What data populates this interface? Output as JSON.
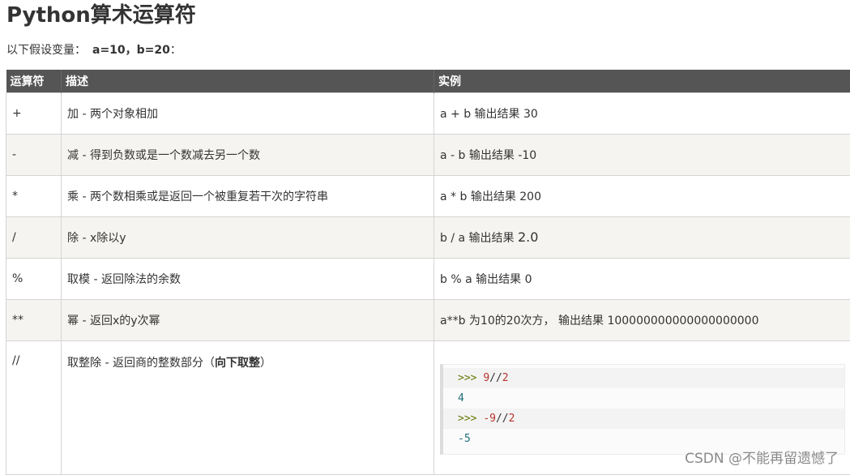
{
  "title": "Python算术运算符",
  "intro": {
    "text": "以下假设变量：",
    "vars": "a=10，b=20",
    "colon": "："
  },
  "table": {
    "headers": [
      "运算符",
      "描述",
      "实例"
    ],
    "rows": [
      {
        "op": "+",
        "desc": "加 - 两个对象相加",
        "example": "a + b 输出结果 30"
      },
      {
        "op": "-",
        "desc": "减 - 得到负数或是一个数减去另一个数",
        "example": "a - b 输出结果 -10"
      },
      {
        "op": "*",
        "desc": "乘 - 两个数相乘或是返回一个被重复若干次的字符串",
        "example": "a * b 输出结果 200"
      },
      {
        "op": "/",
        "desc": "除 - x除以y",
        "example": "b / a 输出结果 ",
        "example_big": "2.0"
      },
      {
        "op": "%",
        "desc": "取模 - 返回除法的余数",
        "example": "b % a 输出结果 0"
      },
      {
        "op": "**",
        "desc": "幂 - 返回x的y次幂",
        "example": "a**b 为10的20次方， 输出结果 100000000000000000000"
      },
      {
        "op": "//",
        "desc": "取整除 - 返回商的整数部分（",
        "desc_bold": "向下取整",
        "desc_end": "）"
      }
    ]
  },
  "code": {
    "line1_prompt": ">>> ",
    "line1_a": "9",
    "line1_op": "//",
    "line1_b": "2",
    "line2": "4",
    "line3_prompt": ">>> ",
    "line3_a": "-9",
    "line3_op": "//",
    "line3_b": "2",
    "line4": "-5"
  },
  "watermark": "CSDN @不能再留遗憾了"
}
